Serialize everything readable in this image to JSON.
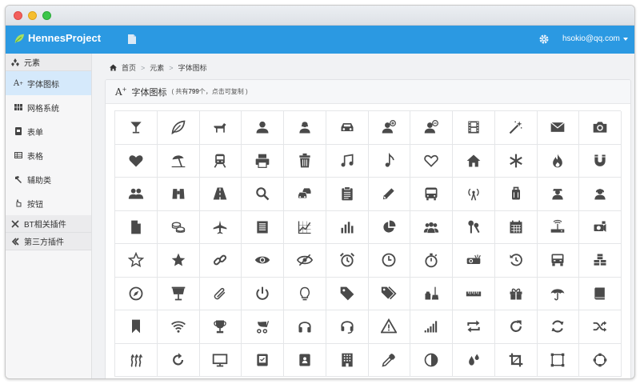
{
  "colors": {
    "nav": "#2b99e2",
    "icon": "#4a4a4a",
    "sidebar_active": "#d5e9fb"
  },
  "navbar": {
    "brand": "HennesProject",
    "user": "hsokio@qq.com"
  },
  "sidebar": {
    "group_elements": "元素",
    "items": [
      "字体图标",
      "网格系统",
      "表单",
      "表格",
      "辅助类",
      "按钮"
    ],
    "group_bt": "BT相关插件",
    "group_third": "第三方插件"
  },
  "breadcrumb": {
    "home": "首页",
    "sep": ">",
    "level1": "元素",
    "current": "字体图标"
  },
  "panel": {
    "title": "字体图标",
    "sub_prefix": "( 共有",
    "count": "799",
    "sub_suffix": "个，点击可复制 )"
  },
  "icons": [
    "glass-icon",
    "leaf-icon",
    "dog-icon",
    "user-icon",
    "girl-icon",
    "car-icon",
    "user-add-icon",
    "user-remove-icon",
    "film-icon",
    "magic-icon",
    "envelope-icon",
    "camera-icon",
    "heart-icon",
    "beach-umbrella-icon",
    "train-icon",
    "print-icon",
    "bin-icon",
    "music-icon",
    "note-icon",
    "heart-empty-icon",
    "home-icon",
    "snowflake-icon",
    "fire-icon",
    "magnet-icon",
    "parents-icon",
    "binoculars-icon",
    "road-icon",
    "search-icon",
    "cars-icon",
    "notes-icon",
    "pencil-icon",
    "bus-icon",
    "wifi-alt-icon",
    "luggage-icon",
    "old-man-icon",
    "woman-icon",
    "file-icon",
    "coins-icon",
    "airplane-icon",
    "notes-2-icon",
    "stats-icon",
    "charts-icon",
    "pie-chart-icon",
    "group-icon",
    "keys-icon",
    "calendar-icon",
    "router-icon",
    "camera-small-icon",
    "star-empty-icon",
    "star-icon",
    "link-icon",
    "eye-open-icon",
    "eye-close-icon",
    "alarm-icon",
    "clock-icon",
    "stopwatch-icon",
    "projector-icon",
    "history-icon",
    "truck-icon",
    "cargo-icon",
    "compass-icon",
    "keynote-icon",
    "paperclip-icon",
    "power-icon",
    "lightbulb-icon",
    "tag-icon",
    "tags-icon",
    "cleaning-icon",
    "ruler-icon",
    "gift-icon",
    "umbrella-icon",
    "book-icon",
    "bookmark-icon",
    "wifi-icon",
    "cup-icon",
    "stroller-icon",
    "headphones-icon",
    "headset-icon",
    "warning-sign-icon",
    "signal-icon",
    "retweet-icon",
    "refresh-icon",
    "roundabout-icon",
    "random-icon",
    "heat-icon",
    "repeat-icon",
    "display-icon",
    "log-book-icon",
    "address-book-icon",
    "building-icon",
    "eyedropper-icon",
    "adjust-icon",
    "tint-icon",
    "crop-icon",
    "vector-path-square-icon",
    "vector-path-circle-icon"
  ]
}
